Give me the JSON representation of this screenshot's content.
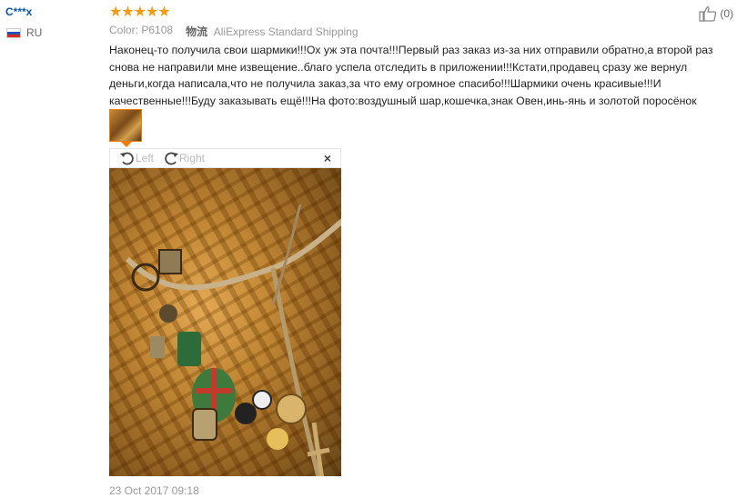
{
  "user": {
    "name": "C***x",
    "country": "RU",
    "flag_colors": [
      "#ffffff",
      "#2553b4",
      "#d52b1e"
    ]
  },
  "rating": {
    "stars": 5,
    "color": "#f39c12"
  },
  "helpful": {
    "count": "(0)",
    "icon": "thumbs-up-icon"
  },
  "meta": {
    "color_label": "Color:",
    "color_value": "P6108",
    "shipping_label": "物流",
    "shipping_value": "AliExpress Standard Shipping"
  },
  "review_text": "Наконец-то получила свои шармики!!!Ох уж эта почта!!!Первый раз заказ из-за них отправили обратно,а второй раз снова не направили мне извещение..благо успела отследить в приложении!!!Кстати,продавец сразу же вернул деньги,когда написала,что не получила заказ,за что ему огромное спасибо!!!Шармики очень красивые!!!И качественные!!!Буду заказывать ещё!!!На фото:воздушный шар,кошечка,знак Овен,инь-янь и золотой поросёнок",
  "viewer": {
    "rotate_left": "Left",
    "rotate_right": "Right",
    "close": "×"
  },
  "accent_color": "#f27c00",
  "date": "23 Oct 2017 09:18"
}
